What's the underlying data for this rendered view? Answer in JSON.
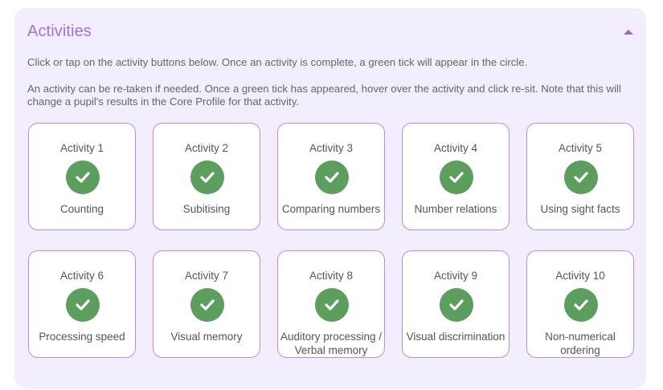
{
  "panel": {
    "title": "Activities",
    "collapse_icon": "chevron-up-icon",
    "intro": [
      "Click or tap on the activity buttons below. Once an activity is complete, a green tick will appear in the circle.",
      "An activity can be re-taken if needed. Once a green tick has appeared, hover over the activity and click re-sit. Note that this will change a pupil's results in the Core Profile for that activity."
    ],
    "accent_color": "#a46fdc",
    "tick_color": "#5c9e5e"
  },
  "activities": [
    {
      "title": "Activity 1",
      "label": "Counting",
      "status_icon": "check-icon"
    },
    {
      "title": "Activity 2",
      "label": "Subitising",
      "status_icon": "check-icon"
    },
    {
      "title": "Activity 3",
      "label": "Comparing numbers",
      "status_icon": "check-icon"
    },
    {
      "title": "Activity 4",
      "label": "Number relations",
      "status_icon": "check-icon"
    },
    {
      "title": "Activity 5",
      "label": "Using sight facts",
      "status_icon": "check-icon"
    },
    {
      "title": "Activity 6",
      "label": "Processing speed",
      "status_icon": "check-icon"
    },
    {
      "title": "Activity 7",
      "label": "Visual memory",
      "status_icon": "check-icon"
    },
    {
      "title": "Activity 8",
      "label": "Auditory processing / Verbal memory",
      "status_icon": "check-icon"
    },
    {
      "title": "Activity 9",
      "label": "Visual discrimination",
      "status_icon": "check-icon"
    },
    {
      "title": "Activity 10",
      "label": "Non-numerical ordering",
      "status_icon": "check-icon"
    }
  ]
}
